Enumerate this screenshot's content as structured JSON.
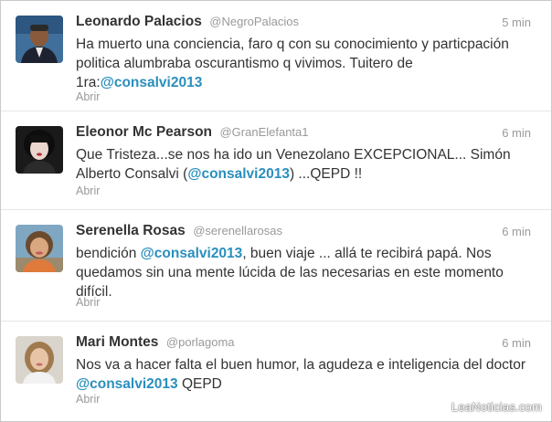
{
  "tweets": [
    {
      "name": "Leonardo Palacios",
      "handle": "@NegroPalacios",
      "time": "5 min",
      "text_parts": [
        "Ha muerto una conciencia, faro q con su conocimiento y particpación politica alumbraba oscurantismo q vivimos. Tuitero de 1ra:",
        ""
      ],
      "mention": "@consalvi2013",
      "action": "Abrir"
    },
    {
      "name": "Eleonor Mc Pearson",
      "handle": "@GranElefanta1",
      "time": "6 min",
      "text_parts": [
        "Que Tristeza...se nos ha ido un Venezolano EXCEPCIONAL... Simón Alberto Consalvi (",
        ") ...QEPD !!"
      ],
      "mention": "@consalvi2013",
      "action": "Abrir"
    },
    {
      "name": "Serenella Rosas",
      "handle": "@serenellarosas",
      "time": "6 min",
      "text_parts": [
        "bendición ",
        ", buen viaje ... allá te recibirá papá. Nos quedamos sin una mente lúcida de las necesarias en este momento difícil."
      ],
      "mention": "@consalvi2013",
      "action": "Abrir"
    },
    {
      "name": "Mari Montes",
      "handle": "@porlagoma",
      "time": "6 min",
      "text_parts": [
        "Nos va a hacer falta el buen humor, la agudeza e inteligencia del doctor ",
        " QEPD"
      ],
      "mention": "@consalvi2013",
      "action": "Abrir"
    }
  ],
  "watermark": "LeaNoticias.com"
}
